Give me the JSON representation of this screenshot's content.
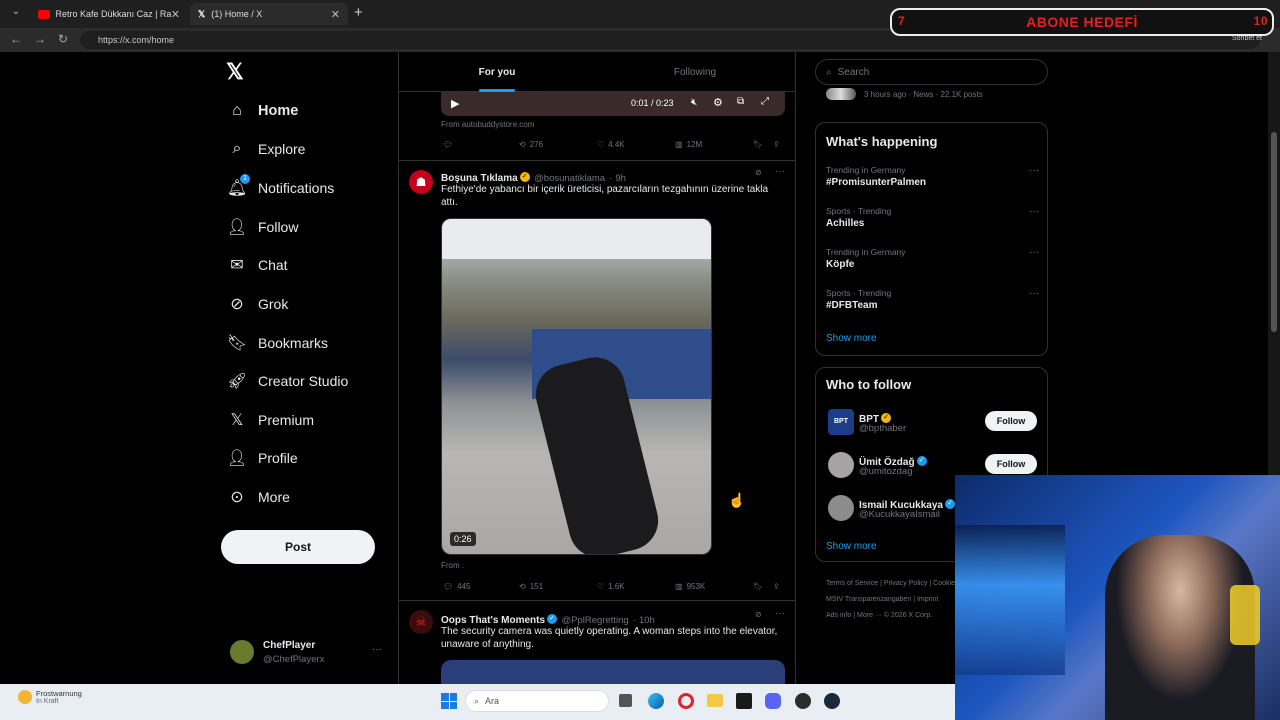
{
  "browser": {
    "tabs": [
      {
        "title": "Retro Kafe Dükkanı Caz | Rahat Bi",
        "icon": "youtube-icon"
      },
      {
        "title": "(1) Home / X",
        "icon": "x-icon"
      }
    ],
    "url": "https://x.com/home",
    "overlay_banner": "ABONE HEDEFİ",
    "overlay_left_num": "7",
    "overlay_right_num": "10",
    "sohbet": "Sohbet et"
  },
  "sidebar": {
    "items": [
      {
        "label": "Home",
        "icon": "home-icon"
      },
      {
        "label": "Explore",
        "icon": "search-icon"
      },
      {
        "label": "Notifications",
        "icon": "bell-icon",
        "badge": "1"
      },
      {
        "label": "Follow",
        "icon": "person-plus-icon"
      },
      {
        "label": "Chat",
        "icon": "mail-icon"
      },
      {
        "label": "Grok",
        "icon": "grok-icon"
      },
      {
        "label": "Bookmarks",
        "icon": "bookmark-icon"
      },
      {
        "label": "Creator Studio",
        "icon": "rocket-icon"
      },
      {
        "label": "Premium",
        "icon": "x-icon"
      },
      {
        "label": "Profile",
        "icon": "person-icon"
      },
      {
        "label": "More",
        "icon": "more-circle-icon"
      }
    ],
    "post_label": "Post",
    "account": {
      "name": "ChefPlayer",
      "handle": "@ChefPlayerx"
    }
  },
  "timeline": {
    "tabs": [
      "For you",
      "Following"
    ],
    "prev_tweet": {
      "video_time": "0:01 / 0:23",
      "from": "From autobuddystore.com",
      "retweets": "276",
      "likes": "4.4K",
      "views": "12M"
    },
    "tweet1": {
      "name": "Boşuna Tıklama",
      "handle": "@bosunatiklama",
      "time": "· 9h",
      "text": "Fethiye'de yabancı bir içerik üreticisi, pazarcıların tezgahının üzerine takla attı.",
      "video_duration": "0:26",
      "from": "From .",
      "replies": "445",
      "retweets": "151",
      "likes": "1.6K",
      "views": "953K"
    },
    "tweet2": {
      "name": "Oops That's Moments",
      "handle": "@PplRegretting",
      "time": "· 10h",
      "text": "The security camera was quietly operating. A woman steps into the elevator, unaware of anything."
    }
  },
  "right": {
    "search_placeholder": "Search",
    "news_meta": "3 hours ago · News · 22.1K posts",
    "happening_title": "What's happening",
    "trends": [
      {
        "context": "Trending in Germany",
        "topic": "#PromisunterPalmen"
      },
      {
        "context": "Sports · Trending",
        "topic": "Achilles"
      },
      {
        "context": "Trending in Germany",
        "topic": "Köpfe"
      },
      {
        "context": "Sports · Trending",
        "topic": "#DFBTeam"
      }
    ],
    "show_more": "Show more",
    "who_title": "Who to follow",
    "who": [
      {
        "name": "BPT",
        "handle": "@bpthaber",
        "follow": "Follow"
      },
      {
        "name": "Ümit Özdağ",
        "handle": "@umitozdag",
        "follow": "Follow"
      },
      {
        "name": "Ismail Kucukkaya",
        "handle": "@KucukkayaIsmail",
        "follow": ""
      }
    ],
    "show_more2": "Show more",
    "footer1": [
      "Terms of Service",
      "|",
      "Privacy Policy",
      "|",
      "Cookie"
    ],
    "footer2": [
      "MStV Transparenzangaben",
      "|",
      "Imprint"
    ],
    "footer3": [
      "Ads info",
      "|",
      "More ···",
      "© 2026 X Corp."
    ]
  },
  "taskbar": {
    "weather_title": "Frostwarnung",
    "weather_sub": "In Kraft",
    "search_placeholder": "Ara"
  }
}
